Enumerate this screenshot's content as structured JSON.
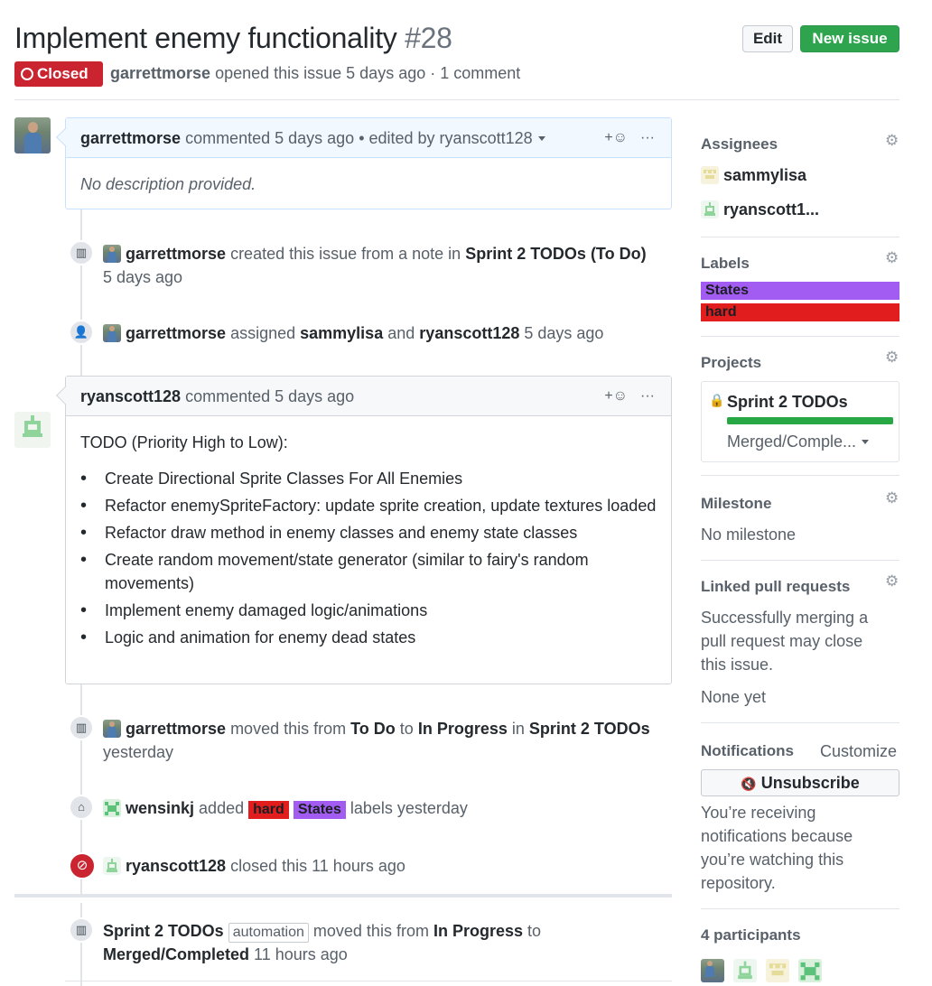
{
  "header": {
    "title": "Implement enemy functionality",
    "number": "#28",
    "edit_label": "Edit",
    "new_issue_label": "New issue",
    "state_label": "Closed",
    "author": "garrettmorse",
    "opened_text": "opened this issue 5 days ago · 1 comment"
  },
  "first_comment": {
    "author": "garrettmorse",
    "commented_text": "commented 5 days ago",
    "edited_text": "• edited by ryanscott128",
    "body": "No description provided."
  },
  "events": {
    "created": {
      "actor": "garrettmorse",
      "text": "created this issue from a note in",
      "project": "Sprint 2 TODOs",
      "column": "(To Do)",
      "time": "5 days ago"
    },
    "assigned": {
      "actor": "garrettmorse",
      "text": "assigned",
      "user1": "sammylisa",
      "and": "and",
      "user2": "ryanscott128",
      "time": "5 days ago"
    },
    "moved": {
      "actor": "garrettmorse",
      "text": "moved this from",
      "from": "To Do",
      "to_word": "to",
      "to": "In Progress",
      "in_word": "in",
      "project": "Sprint 2 TODOs",
      "time": "yesterday"
    },
    "labeled": {
      "actor": "wensinkj",
      "text": "added",
      "label1": "hard",
      "label2": "States",
      "suffix": "labels yesterday"
    },
    "closed": {
      "actor": "ryanscott128",
      "text": "closed this 11 hours ago"
    },
    "auto_moved": {
      "project": "Sprint 2 TODOs",
      "tag": "automation",
      "text": "moved this from",
      "from": "In Progress",
      "to_word": "to",
      "to": "Merged/Completed",
      "time": "11 hours ago"
    }
  },
  "second_comment": {
    "author": "ryanscott128",
    "commented_text": "commented 5 days ago",
    "intro": "TODO (Priority High to Low):",
    "items": [
      "Create Directional Sprite Classes For All Enemies",
      "Refactor enemySpriteFactory: update sprite creation, update textures loaded",
      "Refactor draw method in enemy classes and enemy state classes",
      "Create random movement/state generator (similar to fairy's random movements)",
      "Implement enemy damaged logic/animations",
      "Logic and animation for enemy dead states"
    ]
  },
  "sidebar": {
    "assignees": {
      "heading": "Assignees",
      "users": [
        "sammylisa",
        "ryanscott1..."
      ]
    },
    "labels": {
      "heading": "Labels",
      "items": [
        {
          "name": "States",
          "color": "#a35cf2"
        },
        {
          "name": "hard",
          "color": "#e11d1d"
        }
      ]
    },
    "projects": {
      "heading": "Projects",
      "project_name": "Sprint 2 TODOs",
      "status": "Merged/Comple...",
      "progress": 1.0
    },
    "milestone": {
      "heading": "Milestone",
      "value": "No milestone"
    },
    "linked_prs": {
      "heading": "Linked pull requests",
      "description": "Successfully merging a pull request may close this issue.",
      "value": "None yet"
    },
    "notifications": {
      "heading": "Notifications",
      "customize_label": "Customize",
      "unsubscribe_label": "Unsubscribe",
      "reason": "You’re receiving notifications because you’re watching this repository."
    },
    "participants": {
      "heading": "4 participants"
    }
  },
  "colors": {
    "closed_red": "#cb2431",
    "new_issue_green": "#2ea44f",
    "comment_border": "#c8e1ff",
    "project_progress": "#28a745"
  }
}
